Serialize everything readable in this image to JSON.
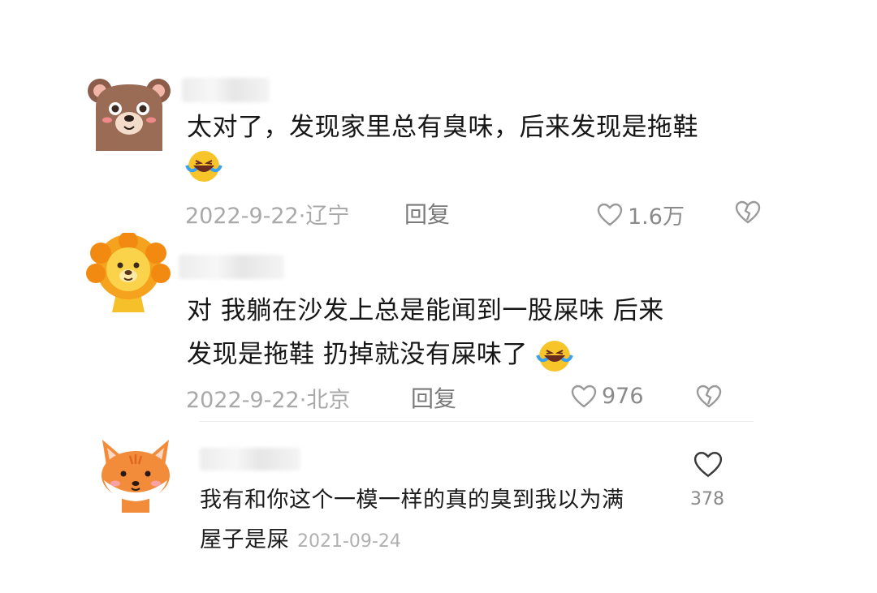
{
  "comments": [
    {
      "avatar": "bear-avatar",
      "text_lines": [
        "太对了，发现家里总有臭味，后来发现是拖鞋"
      ],
      "emoji": "crying-laughing-emoji",
      "date": "2022-9-22",
      "sep": "·",
      "location": "辽宁",
      "reply": "回复",
      "likes": "1.6万"
    },
    {
      "avatar": "lion-avatar",
      "text_lines": [
        "对 我躺在沙发上总是能闻到一股屎味 后来",
        "发现是拖鞋 扔掉就没有屎味了"
      ],
      "emoji": "crying-laughing-emoji",
      "date": "2022-9-22",
      "sep": "·",
      "location": "北京",
      "reply": "回复",
      "likes": "976"
    },
    {
      "avatar": "fox-avatar",
      "text_lines": [
        "我有和你这个一模一样的真的臭到我以为满",
        "屋子是屎"
      ],
      "date": "2021-09-24",
      "likes": "378"
    }
  ],
  "colors": {
    "text": "#161616",
    "meta": "#a9a9a9",
    "icon": "#9a9a9a"
  }
}
